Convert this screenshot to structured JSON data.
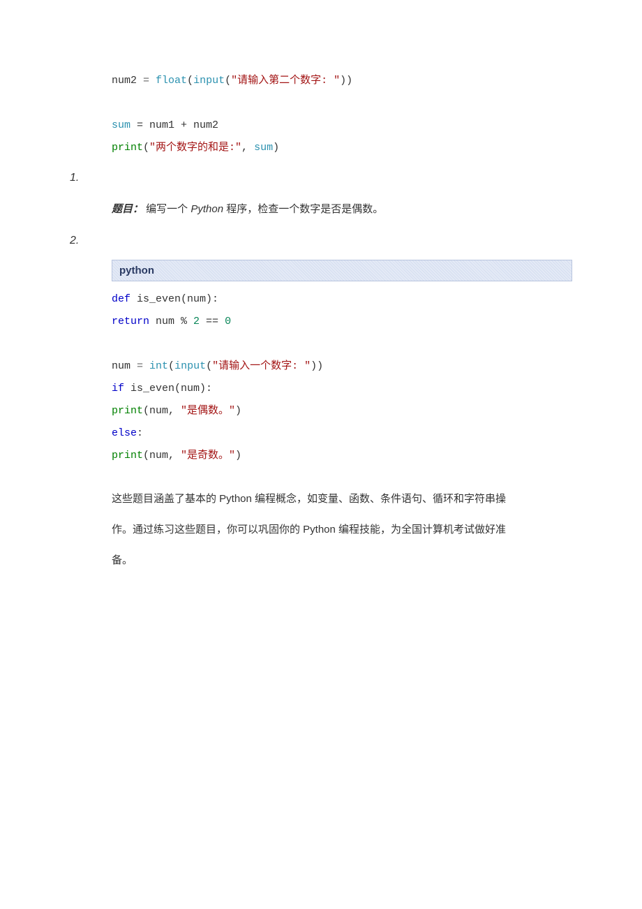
{
  "block1": {
    "l1_var": "num2 ",
    "l1_eq": "= ",
    "l1_float": "float",
    "l1_open": "(",
    "l1_input": "input",
    "l1_args": "(",
    "l1_str": "\"请输入第二个数字: \"",
    "l1_close": "))",
    "l2_var": "sum",
    "l2_rest": " = num1 + num2",
    "l3_print": "print",
    "l3_open": "(",
    "l3_str": "\"两个数字的和是:\"",
    "l3_comma": ", ",
    "l3_sum": "sum",
    "l3_close": ")"
  },
  "list": {
    "n1": "1.",
    "n2": "2."
  },
  "prompt": {
    "label": "题目：",
    "pre": " 编写一个 ",
    "py": "Python ",
    "post": "程序，检查一个数字是否是偶数。"
  },
  "header2": "python",
  "block2": {
    "l1_def": "def",
    "l1_name": " is_even(num):",
    "l2_ret": "return",
    "l2_rest1": " num % ",
    "l2_two": "2",
    "l2_rest2": " == ",
    "l2_zero": "0",
    "l3_var": "num ",
    "l3_eq": "= ",
    "l3_int": "int",
    "l3_open": "(",
    "l3_input": "input",
    "l3_open2": "(",
    "l3_str": "\"请输入一个数字: \"",
    "l3_close": "))",
    "l4_if": "if",
    "l4_rest": " is_even(num):",
    "l5_print": "print",
    "l5_open": "(num, ",
    "l5_str": "\"是偶数。\"",
    "l5_close": ")",
    "l6_else": "else",
    "l6_colon": ":",
    "l7_print": "print",
    "l7_open": "(num, ",
    "l7_str": "\"是奇数。\"",
    "l7_close": ")"
  },
  "footer": {
    "p1a": "这些题目涵盖了基本的 ",
    "p1py": "Python ",
    "p1b": "编程概念，如变量、函数、条件语句、循环和字符串操",
    "p2a": "作。通过练习这些题目，你可以巩固你的 ",
    "p2py": "Python ",
    "p2b": "编程技能，为全国计算机考试做好准",
    "p3": "备。"
  }
}
